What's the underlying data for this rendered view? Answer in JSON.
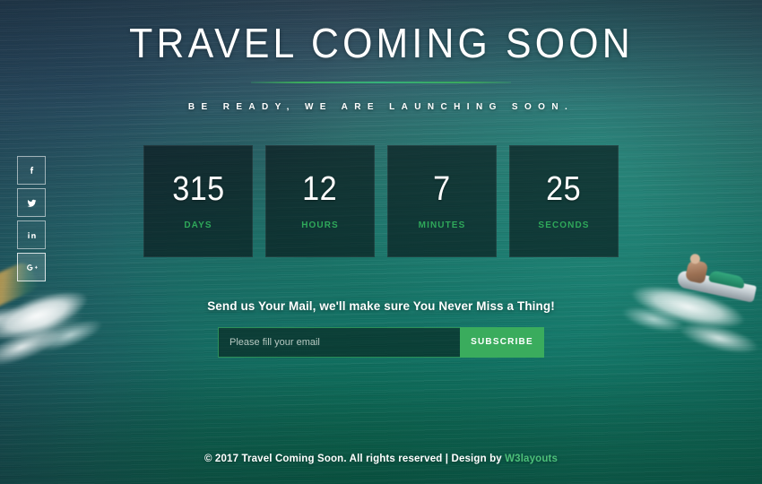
{
  "hero": {
    "title": "TRAVEL COMING SOON",
    "subtitle": "BE READY, WE ARE LAUNCHING SOON.",
    "divider_color": "#3aa85c"
  },
  "social": {
    "items": [
      {
        "name": "facebook",
        "icon": "facebook-icon",
        "label": "f"
      },
      {
        "name": "twitter",
        "icon": "twitter-icon",
        "label": "t"
      },
      {
        "name": "linkedin",
        "icon": "linkedin-icon",
        "label": "in"
      },
      {
        "name": "googleplus",
        "icon": "google-plus-icon",
        "label": "g+"
      }
    ]
  },
  "countdown": {
    "units": [
      {
        "value": "315",
        "label": "DAYS"
      },
      {
        "value": "12",
        "label": "HOURS"
      },
      {
        "value": "7",
        "label": "MINUTES"
      },
      {
        "value": "25",
        "label": "SECONDS"
      }
    ],
    "label_color": "#2fa85a",
    "box_background": "rgba(6,16,20,0.62)"
  },
  "subscribe": {
    "heading": "Send us Your Mail, we'll make sure You Never Miss a Thing!",
    "email_placeholder": "Please fill your email",
    "email_value": "",
    "button_label": "SUBSCRIBE",
    "button_color": "#3aac5d",
    "input_border_color": "#2c8f58"
  },
  "footer": {
    "text": "© 2017 Travel Coming Soon. All rights reserved | Design by ",
    "brand": "W3layouts",
    "brand_color": "#4cc07a"
  },
  "background": {
    "top_color": "#3b5568",
    "mid_color": "#177266",
    "bottom_color": "#0b6650"
  }
}
